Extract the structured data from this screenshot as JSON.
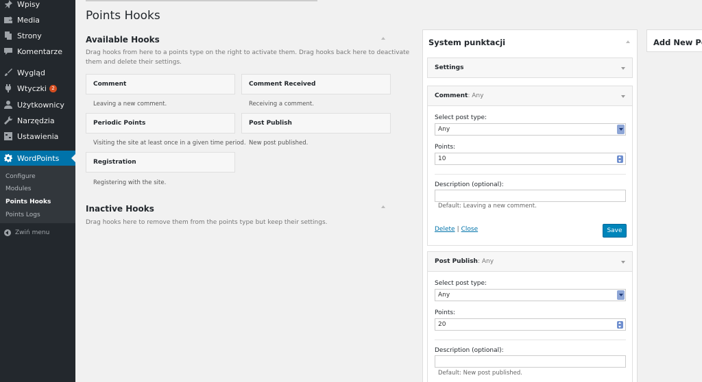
{
  "sidebar": {
    "items": [
      {
        "label": "Wpisy",
        "icon": "pin-icon"
      },
      {
        "label": "Media",
        "icon": "media-icon"
      },
      {
        "label": "Strony",
        "icon": "pages-icon"
      },
      {
        "label": "Komentarze",
        "icon": "comments-icon"
      },
      {
        "label": "Wygląd",
        "icon": "appearance-icon"
      },
      {
        "label": "Wtyczki",
        "icon": "plugins-icon",
        "badge": "2"
      },
      {
        "label": "Użytkownicy",
        "icon": "users-icon"
      },
      {
        "label": "Narzędzia",
        "icon": "tools-icon"
      },
      {
        "label": "Ustawienia",
        "icon": "settings-icon"
      }
    ],
    "active": {
      "label": "WordPoints",
      "icon": "gear-icon"
    },
    "submenu": [
      "Configure",
      "Modules",
      "Points Hooks",
      "Points Logs"
    ],
    "collapse_label": "Zwiń menu"
  },
  "page": {
    "title": "Points Hooks"
  },
  "available": {
    "title": "Available Hooks",
    "description_line1": "Drag hooks from here to a points type on the right to activate them. Drag hooks back here to deactivate",
    "description_line2": "them and delete their settings.",
    "hooks": [
      {
        "name": "Comment",
        "desc": "Leaving a new comment."
      },
      {
        "name": "Comment Received",
        "desc": "Receiving a comment."
      },
      {
        "name": "Periodic Points",
        "desc": "Visiting the site at least once in a given time period."
      },
      {
        "name": "Post Publish",
        "desc": "New post published."
      },
      {
        "name": "Registration",
        "desc": "Registering with the site."
      }
    ]
  },
  "inactive": {
    "title": "Inactive Hooks",
    "description": "Drag hooks here to remove them from the points type but keep their settings."
  },
  "points_type": {
    "title": "System punktacji",
    "settings_label": "Settings",
    "hooks": [
      {
        "name": "Comment",
        "sub": ": Any",
        "post_type_label": "Select post type:",
        "post_type_value": "Any",
        "points_label": "Points:",
        "points_value": "10",
        "description_label": "Description (optional):",
        "default_hint": "Default: Leaving a new comment.",
        "delete_label": "Delete",
        "close_label": "Close",
        "separator": "|",
        "save_label": "Save"
      },
      {
        "name": "Post Publish",
        "sub": ": Any",
        "post_type_label": "Select post type:",
        "post_type_value": "Any",
        "points_label": "Points:",
        "points_value": "20",
        "description_label": "Description (optional):",
        "default_hint": "Default: New post published."
      }
    ]
  },
  "add_new": {
    "title": "Add New Poi"
  },
  "colors": {
    "sidebar_bg": "#23282d",
    "active_bg": "#0073aa",
    "submenu_bg": "#32373c",
    "badge": "#d54e21",
    "button_primary": "#0085ba",
    "link": "#0073aa",
    "page_bg": "#f1f1f1"
  }
}
